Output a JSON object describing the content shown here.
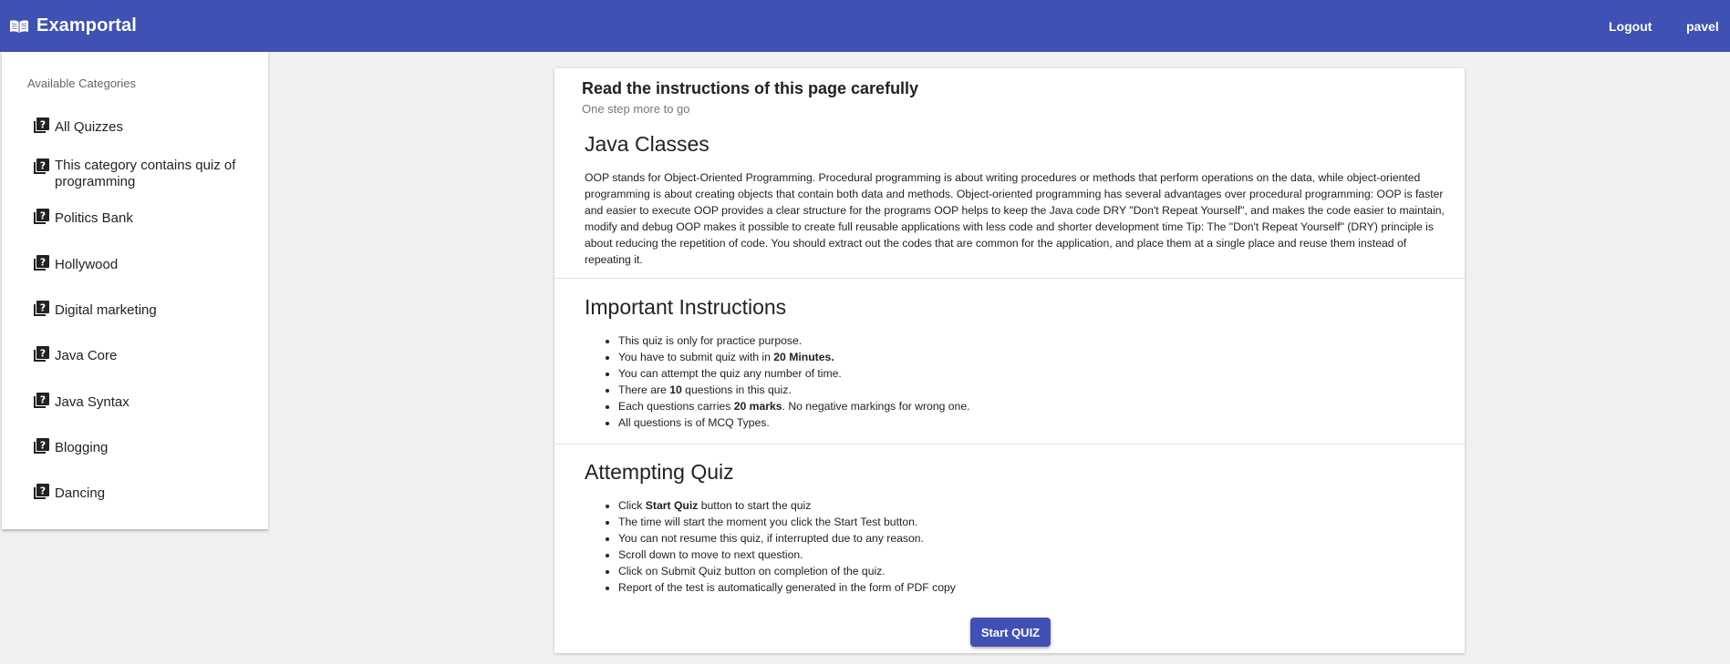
{
  "header": {
    "brand": "Examportal",
    "logout": "Logout",
    "username": "pavel"
  },
  "sidebar": {
    "heading": "Available Categories",
    "items": [
      {
        "label": "All Quizzes"
      },
      {
        "label": "This category contains quiz of programming"
      },
      {
        "label": "Politics Bank"
      },
      {
        "label": "Hollywood"
      },
      {
        "label": "Digital marketing"
      },
      {
        "label": "Java Core"
      },
      {
        "label": "Java Syntax"
      },
      {
        "label": "Blogging"
      },
      {
        "label": "Dancing"
      }
    ]
  },
  "card": {
    "title": "Read the instructions of this page carefully",
    "subtitle": "One step more to go",
    "quiz": {
      "title": "Java Classes",
      "description": "OOP stands for Object-Oriented Programming. Procedural programming is about writing procedures or methods that perform operations on the data, while object-oriented programming is about creating objects that contain both data and methods. Object-oriented programming has several advantages over procedural programming: OOP is faster and easier to execute OOP provides a clear structure for the programs OOP helps to keep the Java code DRY \"Don't Repeat Yourself\", and makes the code easier to maintain, modify and debug OOP makes it possible to create full reusable applications with less code and shorter development time Tip: The \"Don't Repeat Yourself\" (DRY) principle is about reducing the repetition of code. You should extract out the codes that are common for the application, and place them at a single place and reuse them instead of repeating it."
    },
    "important": {
      "heading": "Important Instructions",
      "items": [
        {
          "pre": "This quiz is only for practice purpose.",
          "bold": "",
          "post": ""
        },
        {
          "pre": "You have to submit quiz with in ",
          "bold": "20 Minutes.",
          "post": ""
        },
        {
          "pre": "You can attempt the quiz any number of time.",
          "bold": "",
          "post": ""
        },
        {
          "pre": "There are ",
          "bold": "10",
          "post": " questions in this quiz."
        },
        {
          "pre": "Each questions carries ",
          "bold": "20 marks",
          "post": ". No negative markings for wrong one."
        },
        {
          "pre": "All questions is of MCQ Types.",
          "bold": "",
          "post": ""
        }
      ]
    },
    "attempting": {
      "heading": "Attempting Quiz",
      "items": [
        {
          "pre": "Click ",
          "bold": "Start Quiz",
          "post": " button to start the quiz"
        },
        {
          "pre": "The time will start the moment you click the Start Test button.",
          "bold": "",
          "post": ""
        },
        {
          "pre": "You can not resume this quiz, if interrupted due to any reason.",
          "bold": "",
          "post": ""
        },
        {
          "pre": "Scroll down to move to next question.",
          "bold": "",
          "post": ""
        },
        {
          "pre": "Click on Submit Quiz button on completion of the quiz.",
          "bold": "",
          "post": ""
        },
        {
          "pre": "Report of the test is automatically generated in the form of PDF copy",
          "bold": "",
          "post": ""
        }
      ]
    },
    "start_button": "Start QUIZ"
  },
  "colors": {
    "primary": "#3f51b5",
    "background": "#f0f0f0"
  },
  "icons": {
    "brand": "book-open-icon",
    "category": "quiz-icon"
  }
}
